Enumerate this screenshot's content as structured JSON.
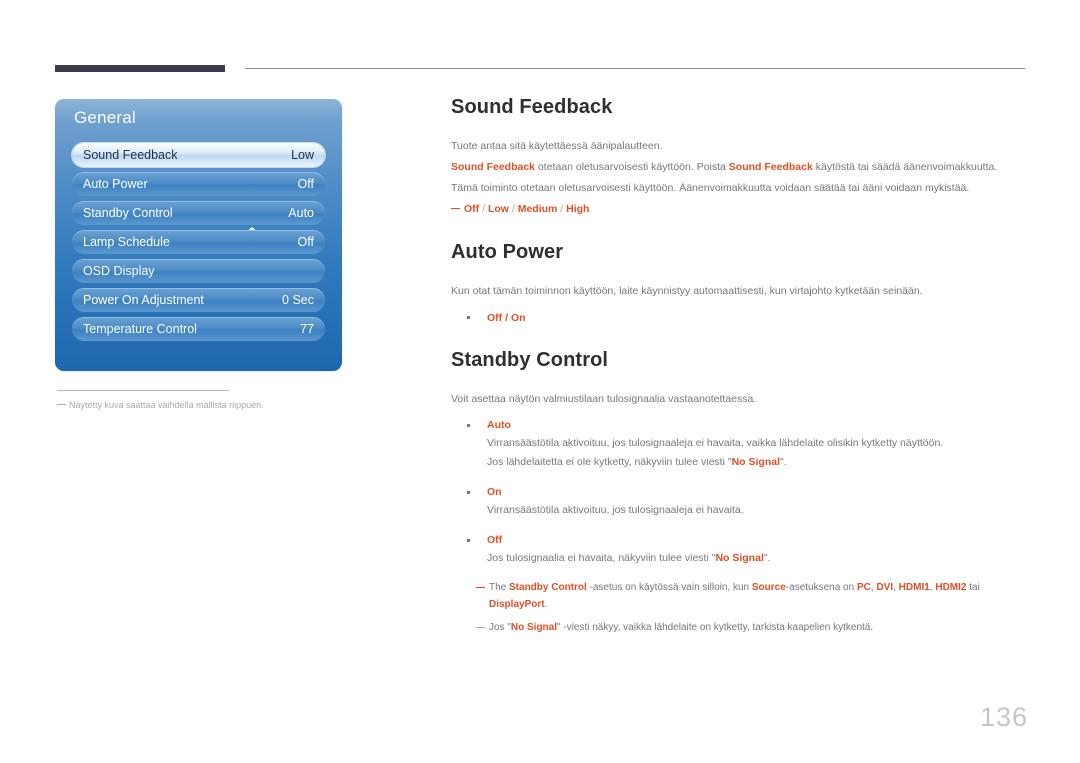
{
  "page": {
    "number": "136"
  },
  "osd": {
    "title": "General",
    "arrow_icon": "chevron-up-icon",
    "rows": [
      {
        "label": "Sound Feedback",
        "value": "Low",
        "selected": true
      },
      {
        "label": "Auto Power",
        "value": "Off",
        "selected": false
      },
      {
        "label": "Standby Control",
        "value": "Auto",
        "selected": false
      },
      {
        "label": "Lamp Schedule",
        "value": "Off",
        "selected": false
      },
      {
        "label": "OSD Display",
        "value": "",
        "selected": false
      },
      {
        "label": "Power On Adjustment",
        "value": "0 Sec",
        "selected": false
      },
      {
        "label": "Temperature Control",
        "value": "77",
        "selected": false
      }
    ]
  },
  "panel_note": {
    "text": "Näytetty kuva saattaa vaihdella mallista riippuen."
  },
  "sections": [
    {
      "title": "Sound Feedback",
      "line1": "Tuote antaa sitä käytettäessä äänipalautteen.",
      "line2_a": "Sound Feedback",
      "line2_b": " otetaan oletusarvoisesti käyttöön. Poista ",
      "line2_c": "Sound Feedback",
      "line2_d": " käytöstä tai säädä äänenvoimakkuutta.",
      "line3": "Tämä toiminto otetaan oletusarvoisesti käyttöön. Äänenvoimakkuutta voidaan säätää tai ääni voidaan mykistää.",
      "options_dash": [
        "Off",
        "Low",
        "Medium",
        "High"
      ]
    },
    {
      "title": "Auto Power",
      "line1": "Kun otat tämän toiminnon käyttöön, laite käynnistyy automaattisesti, kun virtajohto kytketään seinään.",
      "bullet_options": [
        "Off",
        "On"
      ]
    },
    {
      "title": "Standby Control",
      "line1": "Voit asettaa näytön valmiustilaan tulosignaalia vastaanotettaessa.",
      "bullets": [
        {
          "head": "Auto",
          "subs": [
            "Virransäästötila aktivoituu, jos tulosignaaleja ei havaita, vaikka lähdelaite olisikin kytketty näyttöön.",
            "Jos lähdelaitetta ei ole kytketty, näkyviin tulee viesti \"No Signal\"."
          ],
          "sub2_pre": "Jos lähdelaitetta ei ole kytketty, näkyviin tulee viesti \"",
          "sub2_hl": "No Signal",
          "sub2_post": "\"."
        },
        {
          "head": "On",
          "subs": [
            "Virransäästötila aktivoituu, jos tulosignaaleja ei havaita."
          ]
        },
        {
          "head": "Off",
          "sub1_pre": "Jos tulosignaalia ei havaita, näkyviin tulee viesti \"",
          "sub1_hl": "No Signal",
          "sub1_post": "\"."
        }
      ],
      "notes": [
        {
          "p1": "The ",
          "hl1": "Standby Control",
          "p2": " -asetus on käytössä vain silloin, kun ",
          "hl2": "Source",
          "p3": "-asetuksena on ",
          "hl3": "PC",
          "sep1": ", ",
          "hl4": "DVI",
          "sep2": ", ",
          "hl5": "HDMI1",
          "sep3": ", ",
          "hl6": "HDMI2",
          "p4": " tai",
          "cont_hl": "DisplayPort",
          "cont_post": "."
        },
        {
          "p1": "Jos \"",
          "hl1": "No Signal",
          "p2": "\" -viesti näkyy, vaikka lähdelaite on kytketty, tarkista kaapelien kytkentä."
        }
      ]
    }
  ],
  "colors": {
    "accent_orange": "#e04f26",
    "panel_blue_top": "#8fb4d8",
    "panel_blue_bottom": "#1f66b0",
    "header_dark": "#3d3b49",
    "body_gray": "#77777d",
    "page_number_gray": "#c5c5cc"
  }
}
